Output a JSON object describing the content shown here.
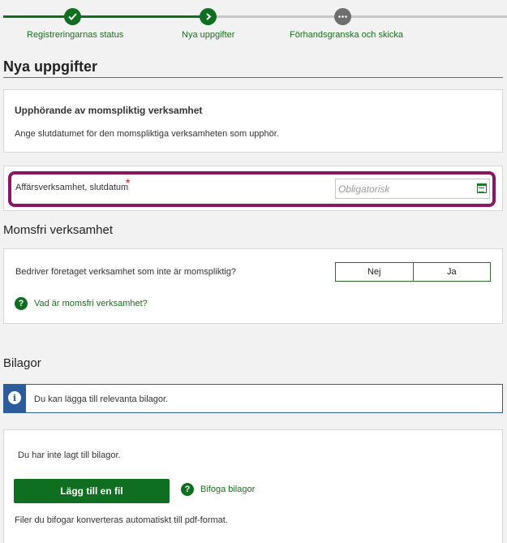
{
  "stepper": {
    "steps": [
      {
        "label": "Registreringarnas status",
        "state": "done",
        "icon": "check-icon"
      },
      {
        "label": "Nya uppgifter",
        "state": "current",
        "icon": "chevron-right-icon"
      },
      {
        "label": "Förhandsgranska och skicka",
        "state": "todo",
        "icon": "more-icon"
      }
    ]
  },
  "page": {
    "title": "Nya uppgifter"
  },
  "cessation": {
    "heading": "Upphörande av momspliktig verksamhet",
    "description": "Ange slutdatumet för den momspliktiga verksamheten som upphör."
  },
  "end_date": {
    "label": "Affärsverksamhet, slutdatum",
    "required_marker": "*",
    "placeholder": "Obligatorisk"
  },
  "vat_exempt": {
    "section_title": "Momsfri verksamhet",
    "question": "Bedriver företaget verksamhet som inte är momspliktig?",
    "option_no": "Nej",
    "option_yes": "Ja",
    "help_link": "Vad är momsfri verksamhet?"
  },
  "attachments": {
    "section_title": "Bilagor",
    "info_text": "Du kan lägga till relevanta bilagor.",
    "empty_text": "Du har inte lagt till bilagor.",
    "add_button": "Lägg till en fil",
    "help_link": "Bifoga bilagor",
    "note": "Filer du bifogar konverteras automatiskt till pdf-format."
  },
  "colors": {
    "primary_green": "#0f6e1f",
    "highlight_magenta": "#8a1563",
    "info_blue": "#2c5c9c",
    "required_red": "#d0101a"
  }
}
